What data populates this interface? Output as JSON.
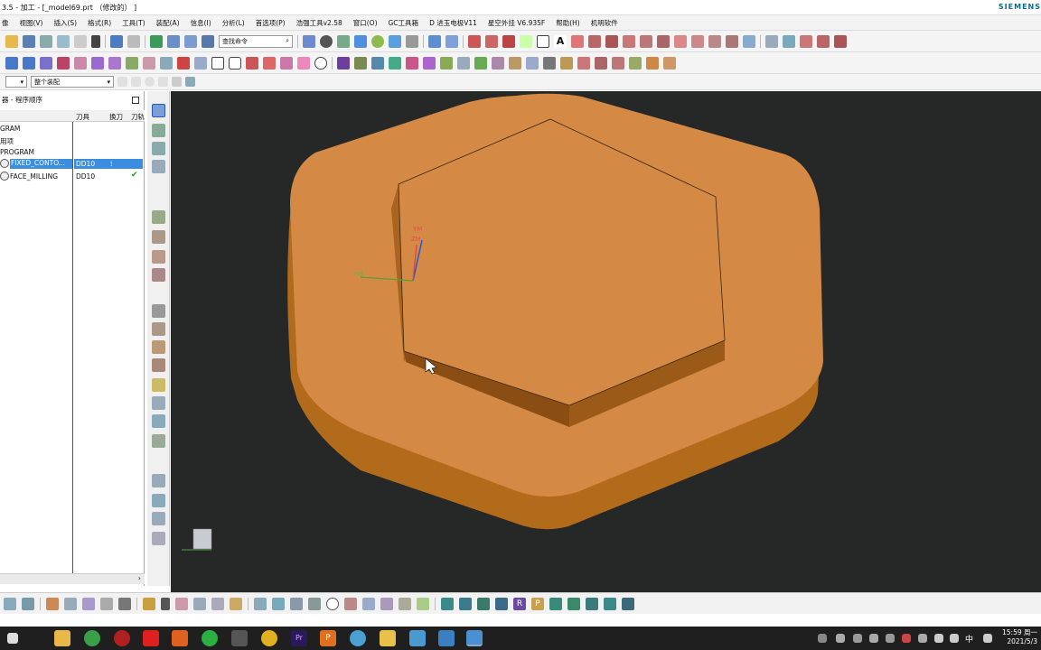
{
  "window": {
    "title": "3.5 - 加工 - [_model69.prt （修改的） ]",
    "brand": "SIEMENS"
  },
  "menu": [
    "像",
    "视图(V)",
    "插入(S)",
    "格式(R)",
    "工具(T)",
    "装配(A)",
    "信息(I)",
    "分析(L)",
    "首选项(P)",
    "浩强工具v2.58",
    "窗口(O)",
    "GC工具箱",
    "D 进玉电极V11",
    "星空外挂 V6.935F",
    "帮助(H)",
    "机明软件"
  ],
  "toolbar": {
    "search_placeholder": "查找命令",
    "filter_value": "",
    "assembly_value": "整个装配"
  },
  "navigator": {
    "title": "器 - 程序顺序",
    "columns": {
      "name": "",
      "tool": "刀具",
      "change": "换刀",
      "path": "刀轨"
    },
    "rows": [
      {
        "name": "GRAM",
        "tool": "",
        "selected": false,
        "check": ""
      },
      {
        "name": "用项",
        "tool": "",
        "selected": false,
        "check": ""
      },
      {
        "name": "PROGRAM",
        "tool": "",
        "selected": false,
        "check": ""
      },
      {
        "name": "FIXED_CONTO...",
        "tool": "DD10",
        "selected": true,
        "check": "⁞"
      },
      {
        "name": "FACE_MILLING",
        "tool": "DD10",
        "selected": false,
        "check": "✔"
      }
    ]
  },
  "viewport": {
    "axis_labels": {
      "ym": "YM",
      "zm": "ZM",
      "xm": "YM"
    },
    "colors": {
      "background": "#262828",
      "part_top": "#D48A45",
      "part_side": "#B26A1B",
      "edge": "#2a1a0a"
    }
  },
  "taskbar": {
    "ime": "中",
    "time": "15:59 周一",
    "date": "2021/5/3"
  }
}
